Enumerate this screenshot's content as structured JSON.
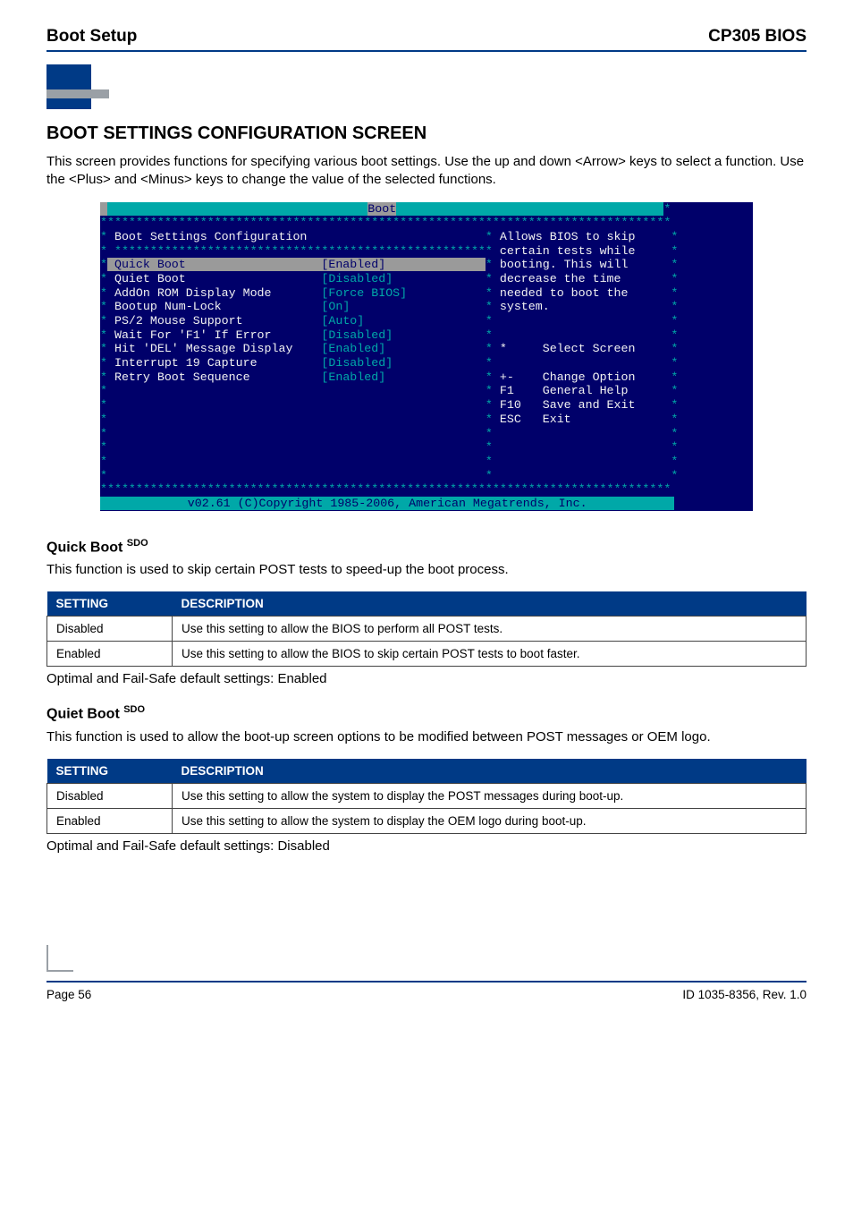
{
  "header": {
    "left": "Boot Setup",
    "right": "CP305 BIOS"
  },
  "section_title": "BOOT SETTINGS CONFIGURATION SCREEN",
  "section_desc": "This screen provides functions for specifying various boot settings. Use the up and down <Arrow> keys to select a function. Use the <Plus> and <Minus> keys to change the value of the selected functions.",
  "bios": {
    "tab": "Boot",
    "heading": "Boot Settings Configuration",
    "rows": [
      {
        "label": "Quick Boot",
        "value": "[Enabled]",
        "hl": true
      },
      {
        "label": "Quiet Boot",
        "value": "[Disabled]",
        "hl": false
      },
      {
        "label": "AddOn ROM Display Mode",
        "value": "[Force BIOS]",
        "hl": false
      },
      {
        "label": "Bootup Num-Lock",
        "value": "[On]",
        "hl": false
      },
      {
        "label": "PS/2 Mouse Support",
        "value": "[Auto]",
        "hl": false
      },
      {
        "label": "Wait For 'F1' If Error",
        "value": "[Disabled]",
        "hl": false
      },
      {
        "label": "Hit 'DEL' Message Display",
        "value": "[Enabled]",
        "hl": false
      },
      {
        "label": "Interrupt 19 Capture",
        "value": "[Disabled]",
        "hl": false
      },
      {
        "label": "Retry Boot Sequence",
        "value": "[Enabled]",
        "hl": false
      }
    ],
    "help_lines": [
      "Allows BIOS to skip",
      "certain tests while",
      "booting. This will",
      "decrease the time",
      "needed to boot the",
      "system."
    ],
    "nav": [
      {
        "key": "*",
        "text": "Select Screen"
      },
      {
        "key": "",
        "text": ""
      },
      {
        "key": "+- ",
        "text": "Change Option"
      },
      {
        "key": "F1 ",
        "text": "General Help"
      },
      {
        "key": "F10",
        "text": "Save and Exit"
      },
      {
        "key": "ESC",
        "text": "Exit"
      }
    ],
    "copyright": "v02.61 (C)Copyright 1985-2006, American Megatrends, Inc."
  },
  "quickboot": {
    "title": "Quick Boot",
    "sup": "SDO",
    "desc": "This function is used to skip certain POST tests to speed-up the boot process.",
    "th1": "SETTING",
    "th2": "DESCRIPTION",
    "r1c1": "Disabled",
    "r1c2": "Use this setting to allow the BIOS to perform all POST tests.",
    "r2c1": "Enabled",
    "r2c2": "Use this setting to allow the BIOS to skip certain POST tests to boot faster.",
    "defaults": "Optimal and Fail-Safe default settings: Enabled"
  },
  "quietboot": {
    "title": "Quiet Boot",
    "sup": "SDO",
    "desc": "This function is used to allow the boot-up screen options to be modified between POST messages or OEM logo.",
    "th1": "SETTING",
    "th2": "DESCRIPTION",
    "r1c1": "Disabled",
    "r1c2": "Use this setting to allow the system to display the POST messages during boot-up.",
    "r2c1": "Enabled",
    "r2c2": "Use this setting to allow the system to display the OEM logo during boot-up.",
    "defaults": "Optimal and Fail-Safe default settings: Disabled"
  },
  "footer": {
    "left": "Page 56",
    "right": "ID 1035-8356, Rev. 1.0"
  }
}
